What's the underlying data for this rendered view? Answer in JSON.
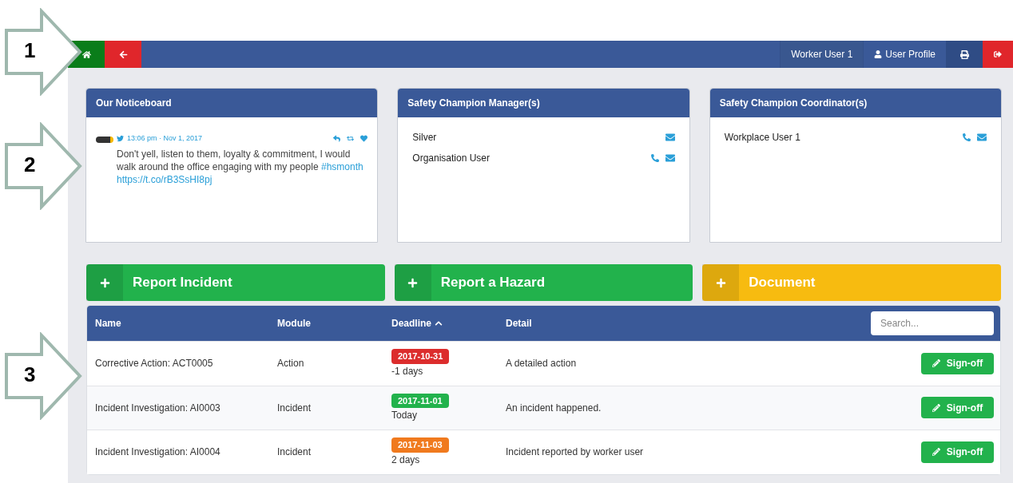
{
  "callouts": [
    "1",
    "2",
    "3"
  ],
  "navbar": {
    "left_buttons": [
      {
        "kind": "home",
        "color": "#0a7d1a"
      },
      {
        "kind": "back",
        "color": "#e0262b"
      }
    ],
    "user": "Worker User 1",
    "profile": "User Profile"
  },
  "panels": [
    {
      "title": "Our Noticeboard",
      "kind": "tweet",
      "tweet": {
        "time": "13:06 pm · Nov 1, 2017",
        "parts": [
          {
            "kind": "text",
            "text": "Don't yell, listen to them, loyalty & commitment, I would walk around the office engaging with my people "
          },
          {
            "kind": "link",
            "text": "#hsmonth"
          },
          {
            "kind": "link",
            "text": "https://t.co/rB3SsHI8pj"
          }
        ]
      }
    },
    {
      "title": "Safety Champion Manager(s)",
      "kind": "contacts",
      "contacts": [
        {
          "name": "Silver",
          "phone": false,
          "email": true
        },
        {
          "name": "Organisation User",
          "phone": true,
          "email": true
        }
      ]
    },
    {
      "title": "Safety Champion Coordinator(s)",
      "kind": "contacts",
      "contacts": [
        {
          "name": "Workplace User 1",
          "phone": true,
          "email": true
        }
      ]
    }
  ],
  "actions": [
    {
      "label": "Report Incident",
      "color": "#22b24c"
    },
    {
      "label": "Report a Hazard",
      "color": "#22b24c"
    },
    {
      "label": "Document",
      "color": "#f7bb10"
    }
  ],
  "table": {
    "columns": [
      {
        "label": "Name",
        "sorted": false
      },
      {
        "label": "Module",
        "sorted": false
      },
      {
        "label": "Deadline",
        "sorted": true
      },
      {
        "label": "Detail",
        "sorted": false
      }
    ],
    "search": {
      "placeholder": "Search..."
    },
    "rows": [
      {
        "name": "Corrective Action: ACT0005",
        "module": "Action",
        "deadline": "2017-10-31",
        "color": "#dc2d2d",
        "due": "-1 days",
        "detail": "A detailed action",
        "action": "Sign-off"
      },
      {
        "name": "Incident Investigation: AI0003",
        "module": "Incident",
        "deadline": "2017-11-01",
        "color": "#22b24c",
        "due": "Today",
        "detail": "An incident happened.",
        "action": "Sign-off"
      },
      {
        "name": "Incident Investigation: AI0004",
        "module": "Incident",
        "deadline": "2017-11-03",
        "color": "#f07a1e",
        "due": "2 days",
        "detail": "Incident reported by worker user",
        "action": "Sign-off"
      }
    ]
  }
}
